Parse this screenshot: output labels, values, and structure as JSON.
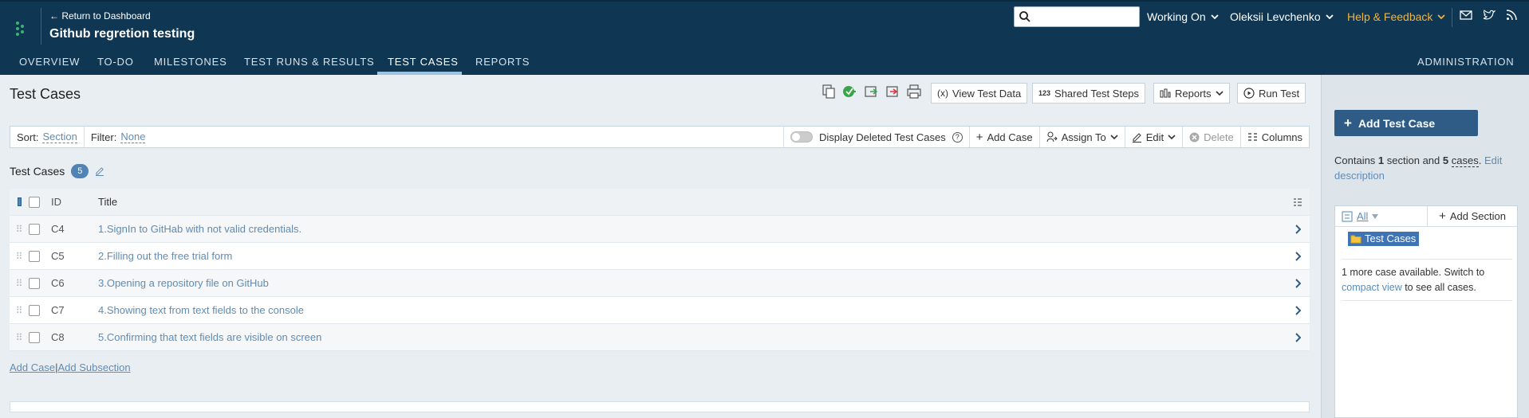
{
  "header": {
    "back_link": "← Return to Dashboard",
    "project_title": "Github regretion testing",
    "working_on": "Working On",
    "user": "Oleksii Levchenko",
    "help": "Help & Feedback"
  },
  "nav": {
    "items": [
      "OVERVIEW",
      "TO-DO",
      "MILESTONES",
      "TEST RUNS & RESULTS",
      "TEST CASES",
      "REPORTS"
    ],
    "active": "TEST CASES",
    "admin": "ADMINISTRATION"
  },
  "toolbar": {
    "page_title": "Test Cases",
    "view_test_data": "View Test Data",
    "shared_steps": "Shared Test Steps",
    "reports": "Reports",
    "run_test": "Run Test"
  },
  "filterbar": {
    "sort_label": "Sort:",
    "sort_value": "Section",
    "filter_label": "Filter:",
    "filter_value": "None",
    "display_deleted": "Display Deleted Test Cases",
    "add_case": "Add Case",
    "assign_to": "Assign To",
    "edit": "Edit",
    "delete": "Delete",
    "columns": "Columns"
  },
  "section": {
    "name": "Test Cases",
    "count": "5"
  },
  "table": {
    "col_id": "ID",
    "col_title": "Title",
    "rows": [
      {
        "id": "C4",
        "title": "1.SignIn to GitHab with not valid credentials."
      },
      {
        "id": "C5",
        "title": "2.Filling out the free trial form"
      },
      {
        "id": "C6",
        "title": "3.Opening a repository file on GitHub"
      },
      {
        "id": "C7",
        "title": "4.Showing text from text fields to the console"
      },
      {
        "id": "C8",
        "title": "5.Confirming that text fields are visible on screen"
      }
    ]
  },
  "bottom": {
    "add_case": "Add Case",
    "separator": "|",
    "add_subsection": "Add Subsection"
  },
  "sidebar": {
    "add_test_case": "Add Test Case",
    "contains_pre": "Contains ",
    "contains_sections": "1",
    "contains_mid": " section and ",
    "contains_cases": "5",
    "contains_cases_word": "cases",
    "contains_post": ". ",
    "edit_description": "Edit description",
    "tree_all": "All",
    "add_section": "Add Section",
    "tree_node": "Test Cases",
    "more_pre": "1 more case available. Switch to ",
    "compact_view": "compact view",
    "more_post": " to see all cases."
  },
  "colors": {
    "header_bg": "#0f3652",
    "link": "#5f8cb5",
    "primary_button": "#2e5c86",
    "help_accent": "#f5b338",
    "badge": "#4f84b5"
  }
}
